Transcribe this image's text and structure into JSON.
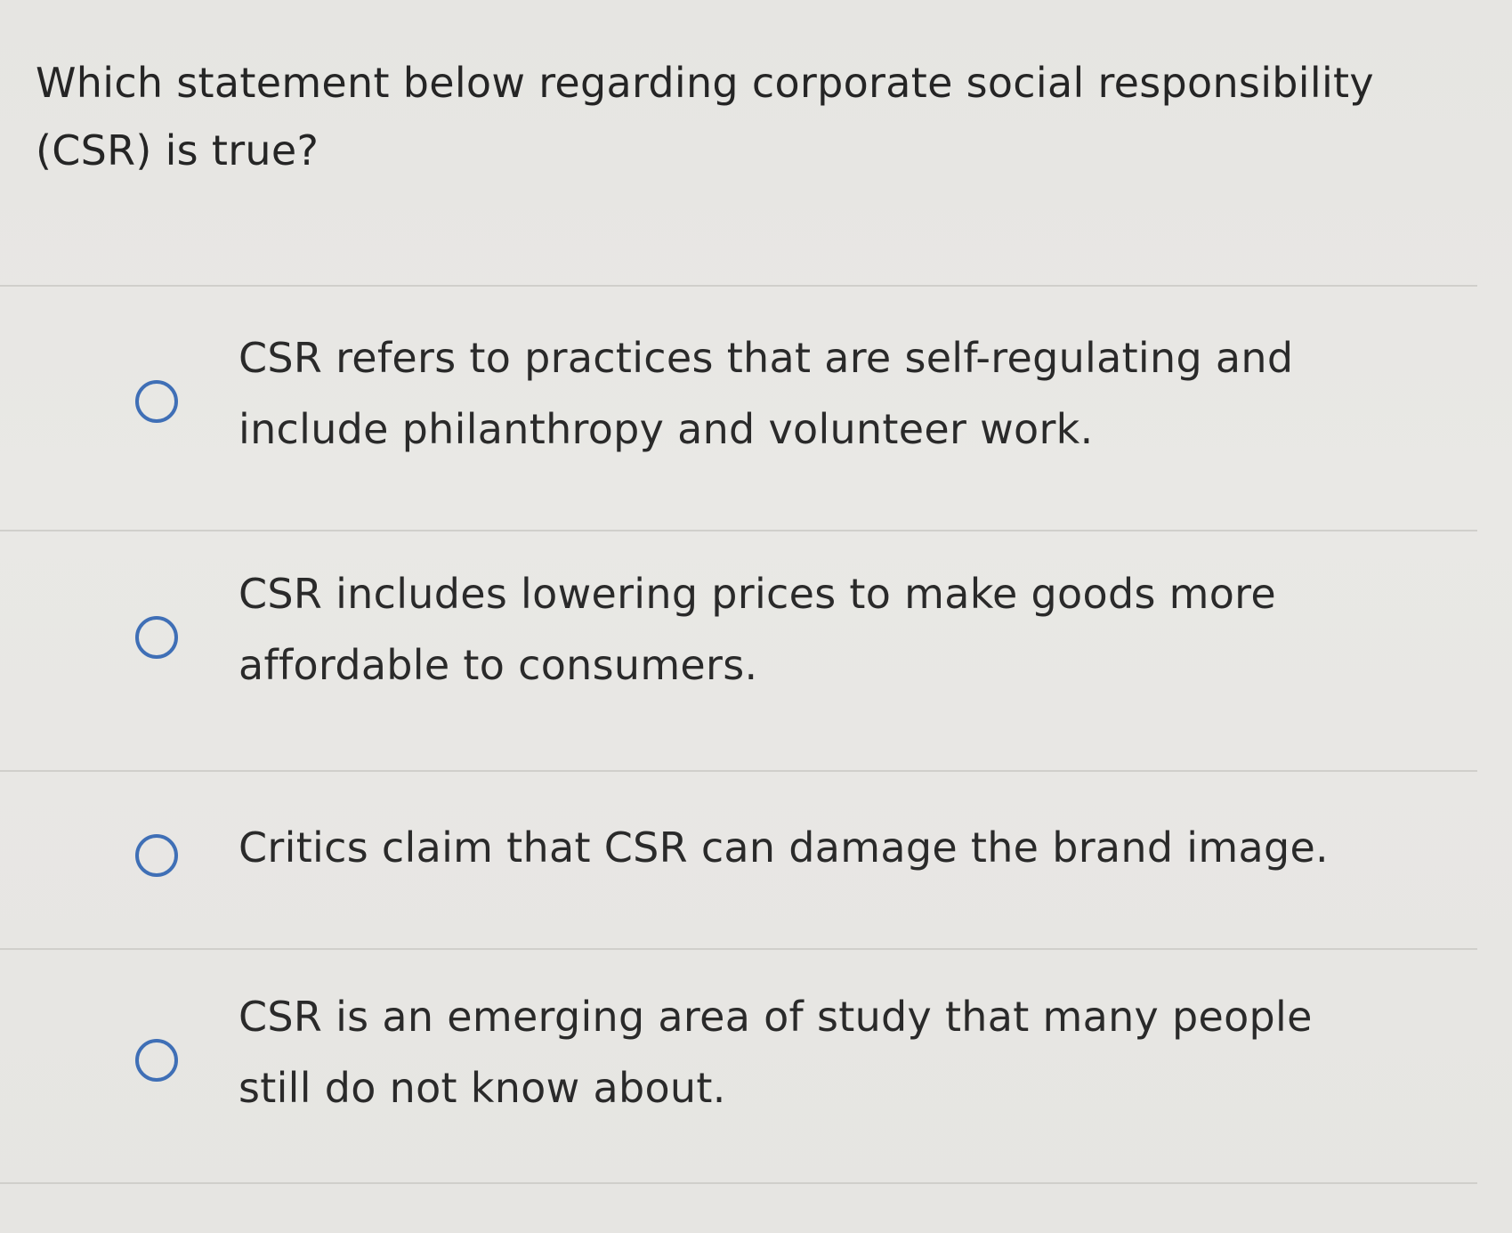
{
  "question": {
    "text": "Which statement below regarding corporate social responsibility (CSR) is true?"
  },
  "answers": [
    {
      "label": "CSR refers to practices that are self-regulating and include philanthropy and volunteer work.",
      "selected": false
    },
    {
      "label": "CSR includes lowering prices to make goods more affordable to consumers.",
      "selected": false
    },
    {
      "label": "Critics claim that CSR can damage the brand image.",
      "selected": false
    },
    {
      "label": "CSR is an emerging area of study that many people still do not know about.",
      "selected": false
    }
  ],
  "colors": {
    "radio_border": "#3f6fb6",
    "background": "#e6e5e2",
    "text": "#2a2a2a"
  }
}
